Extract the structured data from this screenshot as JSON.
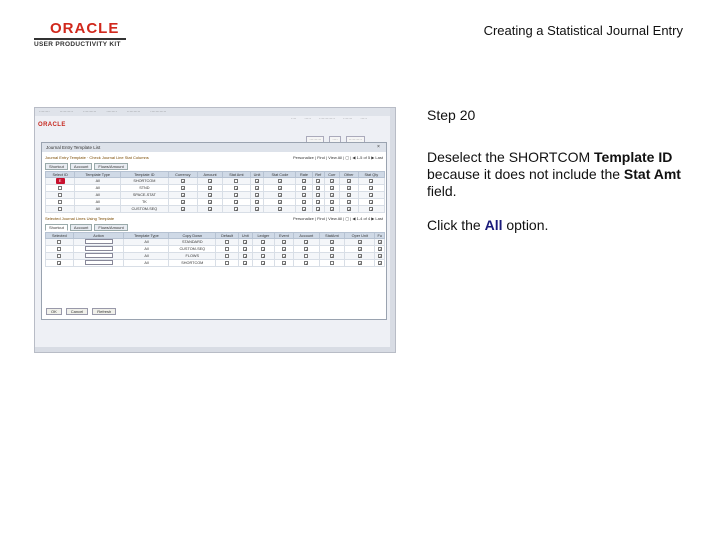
{
  "header": {
    "logo_line1": "ORACLE",
    "logo_line2": "USER PRODUCTIVITY KIT",
    "doc_title": "Creating a Statistical Journal Entry"
  },
  "step": {
    "label": "Step 20",
    "instr_a": "Deselect the SHORTCOM ",
    "instr_b": "Template ID",
    "instr_c": " because it does not include the ",
    "instr_d": "Stat Amt",
    "instr_e": " field.",
    "click_a": "Click the ",
    "click_b": "All",
    "click_c": " option."
  },
  "screenshot": {
    "oracle": "ORACLE",
    "modal_title": "Journal Entry Template List",
    "tabs": [
      "Shortcut",
      "Account",
      "Flows/Amount"
    ],
    "first_row_templates": [
      "SHORTCOM",
      "STND",
      "SPACE-STAT",
      "TK",
      "CUSTOM-SEQ"
    ],
    "second_row_templates": [
      "STANDARD",
      "CUSTOM-SEQ",
      "FLOWS",
      "SHORTCOM"
    ],
    "buttons": [
      "OK",
      "Cancel",
      "Refresh"
    ],
    "badge": "E"
  }
}
